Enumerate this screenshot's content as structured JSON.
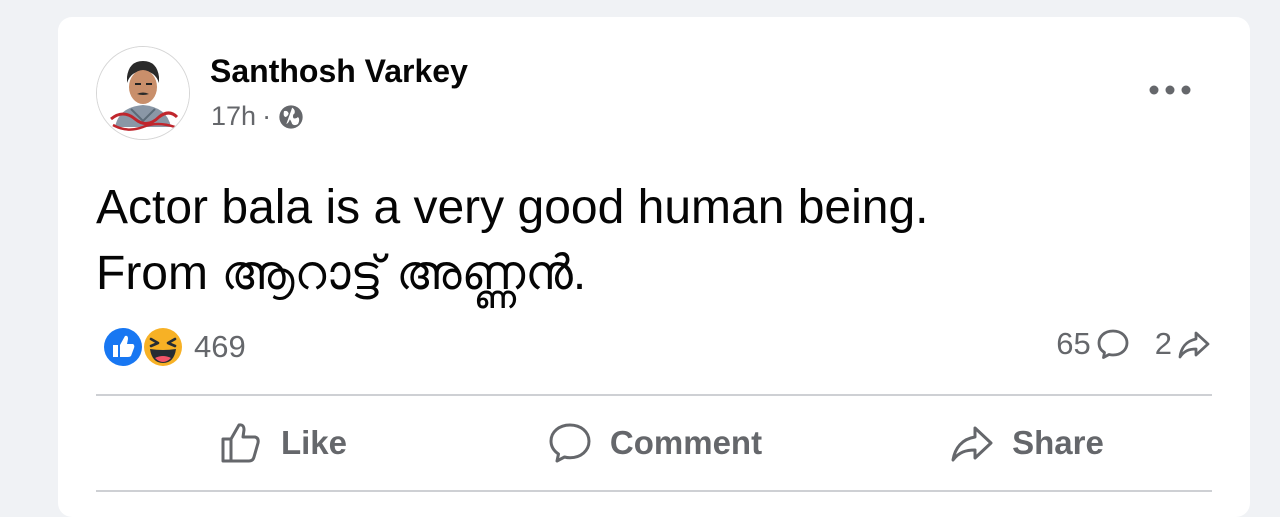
{
  "post": {
    "author": "Santhosh Varkey",
    "time": "17h",
    "separator": "·",
    "privacy_icon": "globe-icon",
    "text_line1": "Actor bala is a very good human being.",
    "text_line2": "From ആറാട്ട് അണ്ണൻ.",
    "more_icon": "more-options-icon"
  },
  "reactions": {
    "icons": [
      "like-reaction-icon",
      "haha-reaction-icon"
    ],
    "count": "469"
  },
  "stats": {
    "comments": "65",
    "shares": "2"
  },
  "actions": {
    "like": "Like",
    "comment": "Comment",
    "share": "Share"
  },
  "colors": {
    "like_blue": "#1877f2",
    "haha_yellow": "#f7b125",
    "secondary_text": "#65676b"
  }
}
